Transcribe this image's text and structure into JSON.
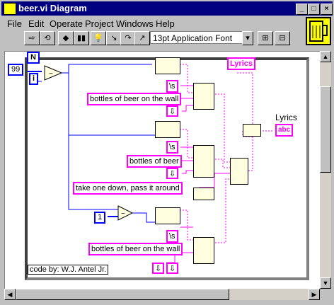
{
  "window": {
    "title": "beer.vi Diagram"
  },
  "menu": {
    "items": [
      {
        "label": "File"
      },
      {
        "label": "Edit"
      },
      {
        "label": "Operate"
      },
      {
        "label": "Project"
      },
      {
        "label": "Windows"
      },
      {
        "label": "Help"
      }
    ]
  },
  "toolbar": {
    "font": "13pt Application Font"
  },
  "diagram": {
    "count_constant": "99",
    "loop_count_label": "N",
    "loop_index_label": "i",
    "one_constant": "1",
    "space_code": "\\s",
    "space_code_2": "\\s",
    "space_code_3": "\\s",
    "str_wall": "bottles of beer on the wall",
    "str_beer": "bottles of beer",
    "str_take": "take one down, pass it around",
    "str_wall_2": "bottles of beer on the wall",
    "lyrics_indicator": "Lyrics",
    "lyrics_label": "Lyrics",
    "lyrics_terminal": "abc",
    "note": "code by: W.J. Antel Jr."
  }
}
